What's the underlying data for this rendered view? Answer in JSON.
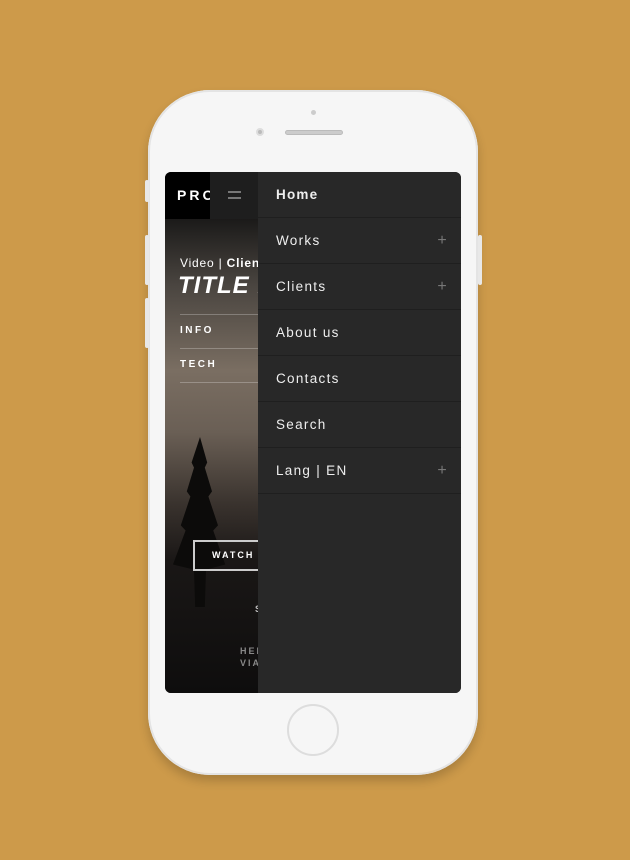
{
  "colors": {
    "background": "#CD9A4A",
    "menu": "#282828",
    "phone": "#f6f6f6"
  },
  "header": {
    "logo": "PRO",
    "menu_icon": "hamburger-icon"
  },
  "hero": {
    "category": "Video | ",
    "client": "Clien",
    "title": "TITLE F",
    "links": [
      "INFO",
      "TECH"
    ],
    "watch_label": "WATCH V",
    "scroll_label": "S",
    "footer_lines": [
      "HEL",
      "VIA"
    ]
  },
  "menu": {
    "items": [
      {
        "label": "Home",
        "expandable": false,
        "active": true
      },
      {
        "label": "Works",
        "expandable": true
      },
      {
        "label": "Clients",
        "expandable": true
      },
      {
        "label": "About us",
        "expandable": false
      },
      {
        "label": "Contacts",
        "expandable": false
      },
      {
        "label": "Search",
        "expandable": false
      },
      {
        "label": "Lang | EN",
        "expandable": true
      }
    ],
    "expand_icon": "+"
  }
}
